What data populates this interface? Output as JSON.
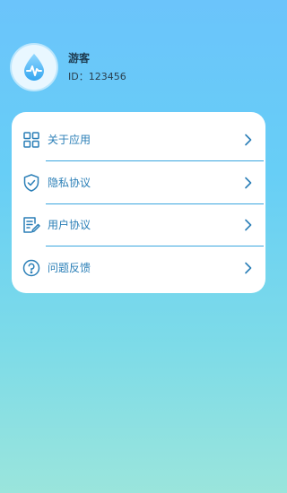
{
  "profile": {
    "avatar_icon": "water-drop-pulse-icon",
    "name": "游客",
    "id_label": "ID：",
    "id_value": "123456"
  },
  "menu": {
    "items": [
      {
        "label": "关于应用",
        "icon": "app-grid-icon"
      },
      {
        "label": "隐私协议",
        "icon": "shield-check-icon"
      },
      {
        "label": "用户协议",
        "icon": "document-edit-icon"
      },
      {
        "label": "问题反馈",
        "icon": "help-circle-icon"
      }
    ],
    "chevron_icon": "chevron-right-icon"
  },
  "colors": {
    "accent": "#2b7fb7",
    "divider": "#3aa6df",
    "background_top": "#6bc4fb",
    "background_bottom": "#9ae5dc"
  }
}
